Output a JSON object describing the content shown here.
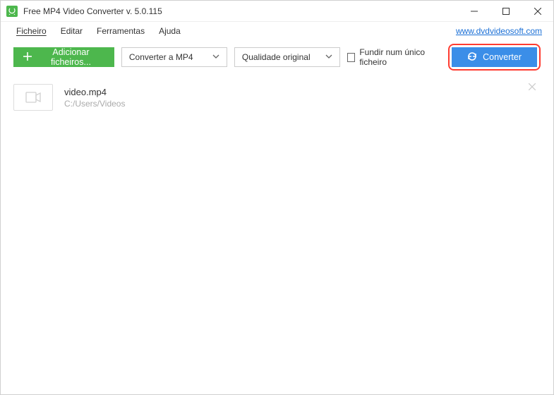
{
  "titlebar": {
    "title": "Free MP4 Video Converter v. 5.0.115"
  },
  "menubar": {
    "items": [
      "Ficheiro",
      "Editar",
      "Ferramentas",
      "Ajuda"
    ],
    "link": "www.dvdvideosoft.com"
  },
  "toolbar": {
    "add_files_label": "Adicionar ficheiros...",
    "format_dropdown": {
      "selected": "Converter a MP4"
    },
    "quality_dropdown": {
      "selected": "Qualidade original"
    },
    "merge_label": "Fundir num único ficheiro",
    "convert_label": "Converter"
  },
  "files": [
    {
      "name": "video.mp4",
      "path": "C:/Users/Videos"
    }
  ]
}
